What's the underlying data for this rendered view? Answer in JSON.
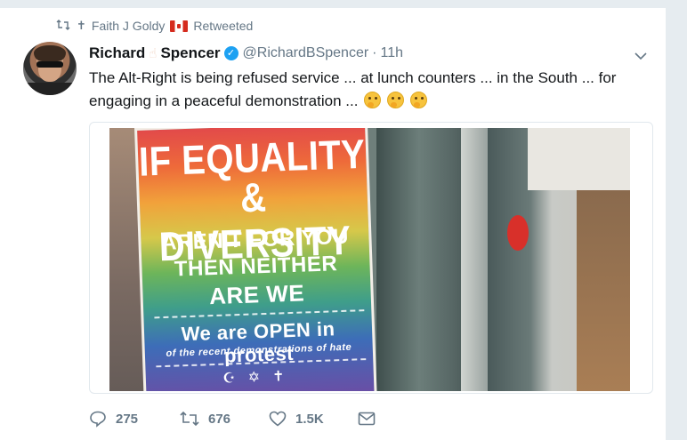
{
  "retweet_context": {
    "icon": "retweet-icon",
    "prefix_symbol": "✝",
    "retweeter_name": "Faith J Goldy",
    "flag": "canada-flag-icon",
    "label": "Retweeted"
  },
  "tweet": {
    "author_name_first": "Richard",
    "author_name_emoji": "☝",
    "author_name_last": "Spencer",
    "verified": true,
    "handle": "@RichardBSpencer",
    "separator": "·",
    "time": "11h",
    "text": "The Alt-Right is being refused service ... at lunch counters ... in the South ... for engaging in a peaceful demonstration ...",
    "text_emoji": [
      "thinking-face",
      "thinking-face",
      "thinking-face"
    ]
  },
  "media": {
    "poster_lines": [
      "IF EQUALITY",
      "& DIVERSITY",
      "AREN'T FOR YOU",
      "THEN NEITHER",
      "ARE WE",
      "We are OPEN in protest",
      "of the recent demonstrations of hate"
    ]
  },
  "actions": {
    "reply_count": "275",
    "retweet_count": "676",
    "like_count": "1.5K"
  },
  "colors": {
    "secondary_text": "#657786",
    "verified_blue": "#1da1f2",
    "background": "#e6ecf0"
  }
}
